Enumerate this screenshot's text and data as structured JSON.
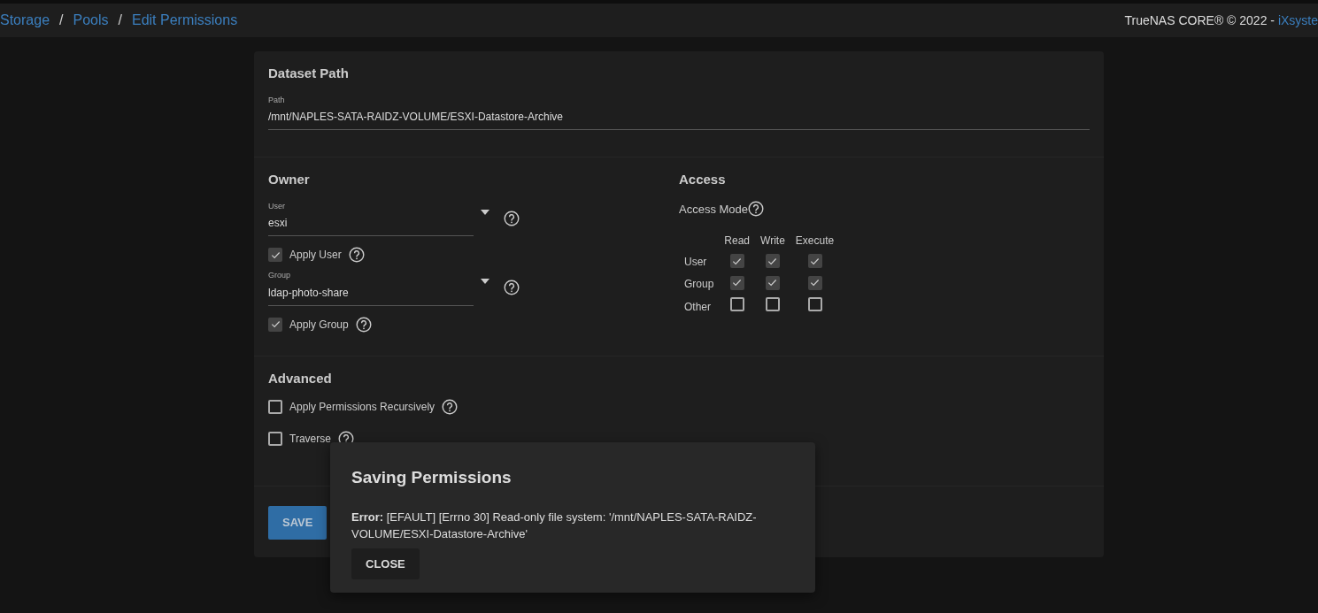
{
  "breadcrumb": [
    {
      "kind": "link",
      "label": "Storage"
    },
    {
      "kind": "separator",
      "label": "/"
    },
    {
      "kind": "link",
      "label": "Pools"
    },
    {
      "kind": "separator",
      "label": "/"
    },
    {
      "kind": "link",
      "label": "Edit Permissions"
    }
  ],
  "copyright": {
    "text": "TrueNAS CORE® © 2022 -",
    "link": "iXsyste"
  },
  "dataset_path": {
    "title": "Dataset Path",
    "label": "Path",
    "value": "/mnt/NAPLES-SATA-RAIDZ-VOLUME/ESXI-Datastore-Archive"
  },
  "owner": {
    "title": "Owner",
    "fields": [
      {
        "label": "User",
        "value": "esxi",
        "apply_label": "Apply User",
        "apply_checked": true
      },
      {
        "label": "Group",
        "value": "ldap-photo-share",
        "apply_label": "Apply Group",
        "apply_checked": true
      }
    ]
  },
  "access": {
    "title": "Access",
    "mode_label": "Access Mode",
    "columns": [
      "Read",
      "Write",
      "Execute"
    ],
    "rows": [
      {
        "label": "User",
        "perms": [
          {
            "checked": true
          },
          {
            "checked": true
          },
          {
            "checked": true
          }
        ]
      },
      {
        "label": "Group",
        "perms": [
          {
            "checked": true
          },
          {
            "checked": true
          },
          {
            "checked": true
          }
        ]
      },
      {
        "label": "Other",
        "perms": [
          {
            "checked": false
          },
          {
            "checked": false
          },
          {
            "checked": false
          }
        ]
      }
    ]
  },
  "advanced": {
    "title": "Advanced",
    "options": [
      {
        "label": "Apply Permissions Recursively",
        "checked": false
      },
      {
        "label": "Traverse",
        "checked": false
      }
    ]
  },
  "save_button": "SAVE",
  "dialog": {
    "title": "Saving Permissions",
    "message": "**Error:** [EFAULT] [Errno 30] Read-only file system: '/mnt/NAPLES-SATA-RAIDZ-VOLUME/ESXI-Datastore-Archive'",
    "button": "CLOSE"
  }
}
